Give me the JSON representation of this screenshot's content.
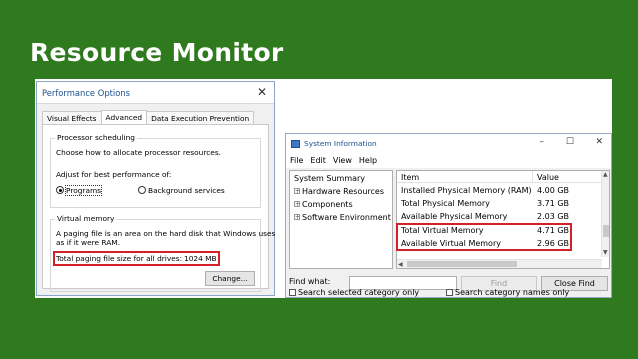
{
  "slide": {
    "title": "Resource Monitor"
  },
  "performance_options": {
    "title": "Performance Options",
    "tabs": [
      "Visual Effects",
      "Advanced",
      "Data Execution Prevention"
    ],
    "active_tab": "Advanced",
    "processor_group": {
      "legend": "Processor scheduling",
      "description": "Choose how to allocate processor resources.",
      "adjust_label": "Adjust for best performance of:",
      "options": [
        "Programs",
        "Background services"
      ],
      "selected": "Programs"
    },
    "virtual_memory_group": {
      "legend": "Virtual memory",
      "description_line1": "A paging file is an area on the hard disk that Windows uses",
      "description_line2": "as if it were RAM.",
      "total_label": "Total paging file size for all drives:",
      "total_value": "1024 MB",
      "change_button": "Change..."
    },
    "highlight_color": "#d42027"
  },
  "system_information": {
    "title": "System Information",
    "window_controls": [
      "–",
      "☐",
      "✕"
    ],
    "menu": [
      "File",
      "Edit",
      "View",
      "Help"
    ],
    "tree": {
      "root": "System Summary",
      "children": [
        "Hardware Resources",
        "Components",
        "Software Environment"
      ]
    },
    "columns": [
      "Item",
      "Value"
    ],
    "rows": [
      {
        "item": "Installed Physical Memory (RAM)",
        "value": "4.00 GB"
      },
      {
        "item": "Total Physical Memory",
        "value": "3.71 GB"
      },
      {
        "item": "Available Physical Memory",
        "value": "2.03 GB"
      },
      {
        "item": "Total Virtual Memory",
        "value": "4.71 GB"
      },
      {
        "item": "Available Virtual Memory",
        "value": "2.96 GB"
      }
    ],
    "find": {
      "label": "Find what:",
      "value": "",
      "find_button": "Find",
      "close_find_button": "Close Find",
      "search_selected_label": "Search selected category only",
      "search_names_label": "Search category names only"
    }
  }
}
